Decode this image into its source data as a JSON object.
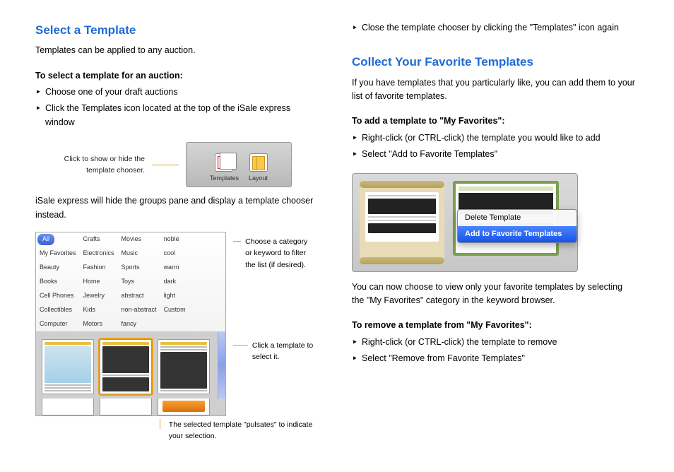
{
  "left": {
    "h_select": "Select a Template",
    "p_intro": "Templates can be applied to any auction.",
    "bold_select": "To select a template for an auction:",
    "bullets": [
      "Choose one of your draft auctions",
      "Click the Templates icon located at the top of the iSale express window"
    ],
    "callout_toolbar": "Click to show or hide the template chooser.",
    "toolbar": {
      "templates": "Templates",
      "layout": "Layout"
    },
    "p_hide": "iSale express will hide the groups pane and display a template chooser instead.",
    "categories": {
      "col1": [
        "My Favorites",
        "Beauty",
        "Books",
        "Cell Phones",
        "Collectibles",
        "Computer"
      ],
      "col2": [
        "Crafts",
        "Electronics",
        "Fashion",
        "Home",
        "Jewelry",
        "Kids",
        "Motors"
      ],
      "col3": [
        "Movies",
        "Music",
        "Sports",
        "Toys",
        "abstract",
        "non-abstract",
        "fancy"
      ],
      "col4": [
        "noble",
        "cool",
        "warm",
        "dark",
        "light",
        "Custom"
      ],
      "all": "All"
    },
    "callout_category": "Choose a category or keyword to filter the list (if desired).",
    "callout_click": "Click a template to select it.",
    "callout_pulsate": "The selected template \"pulsates\" to indicate your selection."
  },
  "right": {
    "bullets_top": [
      "Close the template chooser by clicking the \"Templates\" icon again"
    ],
    "h_collect": "Collect Your Favorite Templates",
    "p_collect": "If you have templates that you particularly like, you can add them to your list of favorite templates.",
    "bold_add": "To add a template to \"My Favorites\":",
    "bullets_add": [
      "Right-click (or CTRL-click) the template you would like to add",
      "Select \"Add to Favorite Templates\""
    ],
    "menu": {
      "delete": "Delete Template",
      "add": "Add to Favorite Templates"
    },
    "p_view": "You can now choose to view only your favorite templates by selecting the \"My Favorites\" category in the keyword browser.",
    "bold_remove": "To remove a template from \"My Favorites\":",
    "bullets_remove": [
      "Right-click (or CTRL-click) the template to remove",
      "Select \"Remove from Favorite Templates\""
    ]
  }
}
